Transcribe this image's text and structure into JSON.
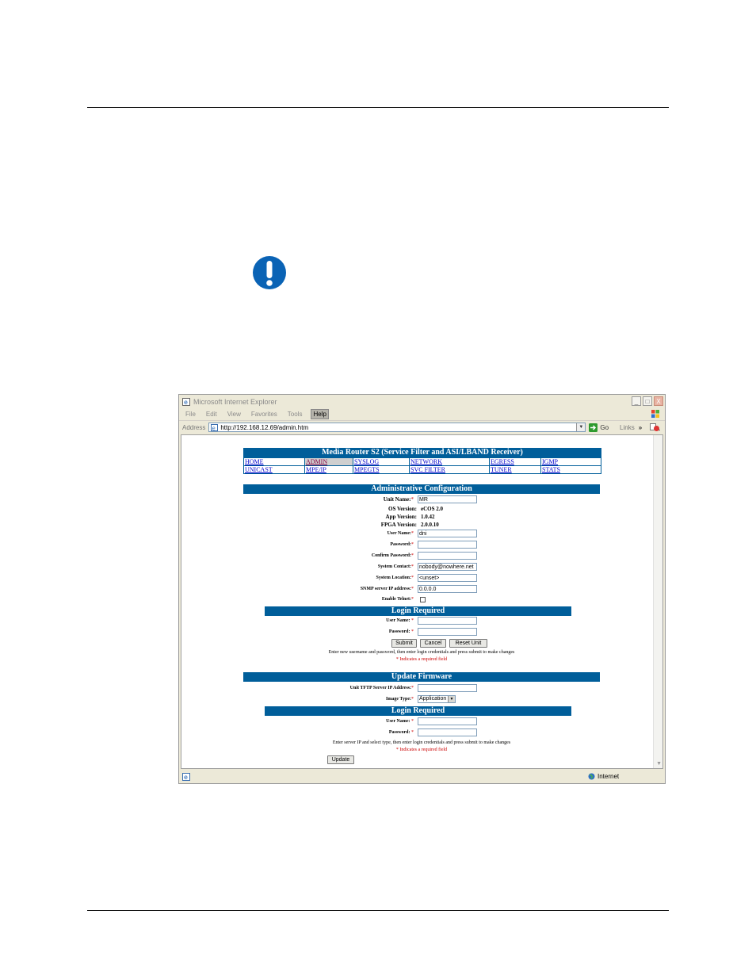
{
  "window": {
    "title": "Microsoft Internet Explorer",
    "menu": [
      "File",
      "Edit",
      "View",
      "Favorites",
      "Tools",
      "Help"
    ],
    "address_label": "Address",
    "address_url": "http://192.168.12.69/admin.htm",
    "go_label": "Go",
    "links_label": "Links",
    "links_chevron": "»",
    "status_zone": "Internet",
    "minimize_glyph": "_",
    "maximize_glyph": "□",
    "close_glyph": "X"
  },
  "page": {
    "banner": "Media Router S2 (Service Filter and ASI/LBAND Receiver)",
    "nav": [
      [
        "HOME",
        "ADMIN",
        "SYSLOG",
        "NETWORK",
        "EGRESS",
        "IGMP"
      ],
      [
        "UNICAST",
        "MPE/IP",
        "MPEGTS",
        "SVC FILTER",
        "TUNER",
        "STATS"
      ]
    ],
    "admin": {
      "heading": "Administrative Configuration",
      "unit_name_label": "Unit Name:",
      "unit_name_value": "MR",
      "os_label": "OS Version:",
      "os_value": "eCOS 2.0",
      "app_label": "App Version:",
      "app_value": "1.0.42",
      "fpga_label": "FPGA Version:",
      "fpga_value": "2.0.0.10",
      "user_label": "User Name:",
      "user_value": "dni",
      "password_label": "Password:",
      "confirm_label": "Confirm Password:",
      "contact_label": "System Contact:",
      "contact_value": "nobody@nowhere.net",
      "location_label": "System Location:",
      "location_value": "<unset>",
      "snmp_label": "SNMP server IP address:",
      "snmp_value": "0.0.0.0",
      "telnet_label": "Enable Telnet:"
    },
    "login1": {
      "heading": "Login Required",
      "user_label": "User Name:",
      "password_label": "Password:",
      "submit": "Submit",
      "cancel": "Cancel",
      "reset": "Reset Unit",
      "instructions": "Enter new username and password, then enter login credentials and press submit to make changes",
      "required_note": "* Indicates a required field"
    },
    "firmware": {
      "heading": "Update Firmware",
      "tftp_label": "Unit TFTP Server IP Address:",
      "image_label": "Image Type:",
      "image_value": "Application"
    },
    "login2": {
      "heading": "Login Required",
      "user_label": "User Name:",
      "password_label": "Password:",
      "instructions": "Enter server IP and select type, then enter login credentials and press submit to make changes",
      "required_note": "* Indicates a required field",
      "update": "Update"
    },
    "required_star": "*"
  }
}
